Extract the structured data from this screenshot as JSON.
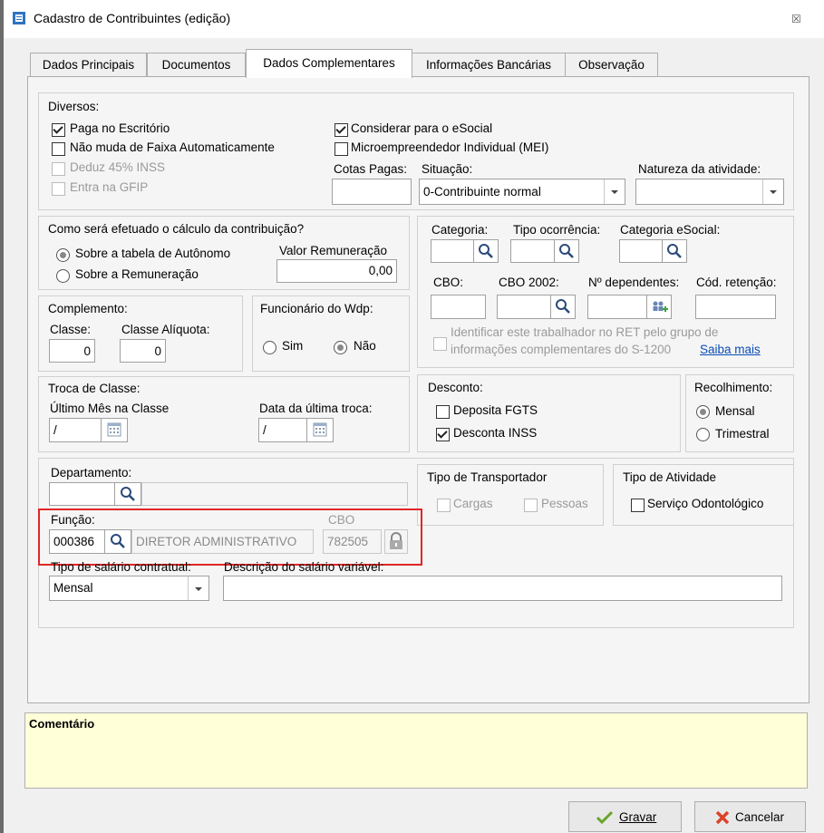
{
  "window": {
    "title": "Cadastro de Contribuintes (edição)",
    "close": "☒"
  },
  "tabs": [
    {
      "label": "Dados Principais"
    },
    {
      "label": "Documentos"
    },
    {
      "label": "Dados Complementares"
    },
    {
      "label": "Informações Bancárias"
    },
    {
      "label": "Observação"
    }
  ],
  "diversos": {
    "title": "Diversos:",
    "paga_escritorio": "Paga no Escritório",
    "nao_muda_faixa": "Não muda de Faixa Automaticamente",
    "deduz_inss": "Deduz 45% INSS",
    "entra_gfip": "Entra na GFIP",
    "considerar_esocial": "Considerar para o eSocial",
    "mei": "Microempreendedor Individual (MEI)",
    "cotas_label": "Cotas Pagas:",
    "situacao_label": "Situação:",
    "situacao_value": "0-Contribuinte normal",
    "natureza_label": "Natureza da atividade:"
  },
  "calculo": {
    "title": "Como será efetuado o cálculo da contribuição?",
    "opt_tabela": "Sobre a tabela de Autônomo",
    "opt_remuneracao": "Sobre a Remuneração",
    "valor_label": "Valor Remuneração",
    "valor": "0,00"
  },
  "categoria": {
    "categoria_label": "Categoria:",
    "tipo_ocorrencia_label": "Tipo ocorrência:",
    "categoria_esocial_label": "Categoria eSocial:",
    "cbo_label": "CBO:",
    "cbo2002_label": "CBO 2002:",
    "dependentes_label": "Nº dependentes:",
    "retencao_label": "Cód. retenção:",
    "ret_text_1": "Identificar este trabalhador no RET pelo grupo de",
    "ret_text_2": "informações complementares do S-1200",
    "saiba_mais": "Saiba mais"
  },
  "complemento": {
    "title": "Complemento:",
    "classe_label": "Classe:",
    "classe_value": "0",
    "aliquota_label": "Classe Alíquota:",
    "aliquota_value": "0"
  },
  "funcionario": {
    "title": "Funcionário do Wdp:",
    "sim": "Sim",
    "nao": "Não"
  },
  "troca": {
    "title": "Troca de Classe:",
    "ultimo_mes_label": "Último Mês na Classe",
    "ultimo_mes_value": "/",
    "data_label": "Data da última troca:",
    "data_value": "/"
  },
  "desconto": {
    "title": "Desconto:",
    "fgts": "Deposita FGTS",
    "inss": "Desconta INSS"
  },
  "recolhimento": {
    "title": "Recolhimento:",
    "mensal": "Mensal",
    "trimestral": "Trimestral"
  },
  "departamento": {
    "label": "Departamento:"
  },
  "transportador": {
    "title": "Tipo de Transportador",
    "cargas": "Cargas",
    "pessoas": "Pessoas"
  },
  "atividade": {
    "title": "Tipo de Atividade",
    "odonto": "Serviço Odontológico"
  },
  "funcao": {
    "label": "Função:",
    "code": "000386",
    "description": "DIRETOR ADMINISTRATIVO",
    "cbo_label": "CBO",
    "cbo_value": "782505"
  },
  "salario": {
    "tipo_label": "Tipo de salário contratual:",
    "tipo_value": "Mensal",
    "descricao_label": "Descrição do salário variável:"
  },
  "comentario": {
    "label": "Comentário"
  },
  "buttons": {
    "gravar": "Gravar",
    "cancelar": "Cancelar"
  },
  "colors": {
    "highlight": "#e32626",
    "link": "#0a4cb5",
    "comment_bg": "#ffffd8"
  }
}
